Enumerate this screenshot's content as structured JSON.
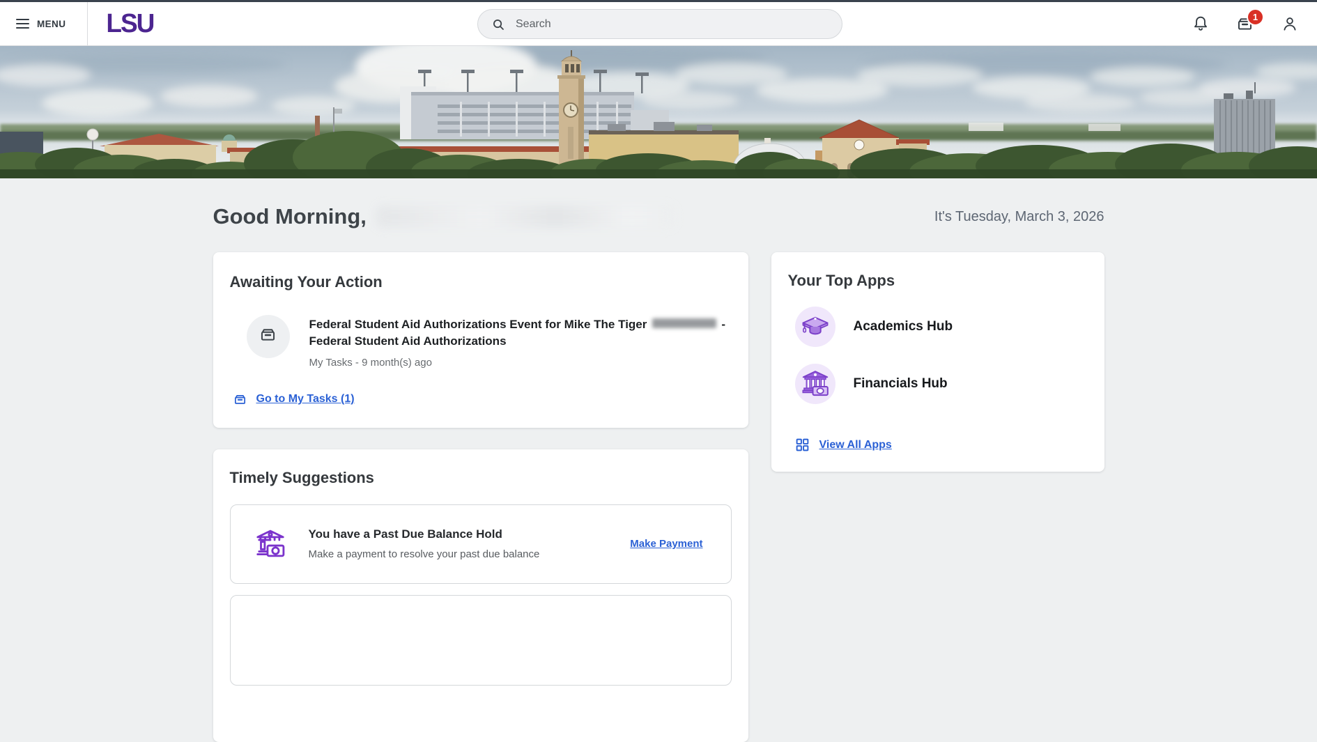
{
  "header": {
    "menu_label": "MENU",
    "logo_text": "LSU",
    "search_placeholder": "Search",
    "inbox_badge": "1",
    "icons": [
      "hamburger-icon",
      "search-icon",
      "bell-icon",
      "inbox-icon",
      "profile-icon"
    ]
  },
  "greeting": {
    "title": "Good Morning,",
    "date_text": "It's Tuesday, March 3, 2026"
  },
  "awaiting_card": {
    "title": "Awaiting Your Action",
    "task": {
      "icon": "inbox-icon",
      "title_start": "Federal Student Aid Authorizations Event for Mike The Tiger",
      "title_end": "- Federal Student Aid Authorizations",
      "meta": "My Tasks - 9 month(s) ago"
    },
    "link_label": "Go to My Tasks (1)"
  },
  "timely_card": {
    "title": "Timely Suggestions",
    "suggestions": [
      {
        "icon": "bank-money-icon",
        "title": "You have a Past Due Balance Hold",
        "description": "Make a payment to resolve your past due balance",
        "action_label": "Make Payment"
      }
    ]
  },
  "top_apps_card": {
    "title": "Your Top Apps",
    "apps": [
      {
        "label": "Academics Hub",
        "icon": "graduation-cap-icon"
      },
      {
        "label": "Financials Hub",
        "icon": "bank-money-icon"
      }
    ],
    "view_all_label": "View All Apps",
    "view_all_icon": "grid-icon"
  },
  "colors": {
    "lsu_purple": "#4c2590",
    "link_blue": "#2b61d5",
    "badge_red": "#d93025",
    "app_purple": "#7b40c9",
    "app_purple_light": "#f0e7fb"
  }
}
